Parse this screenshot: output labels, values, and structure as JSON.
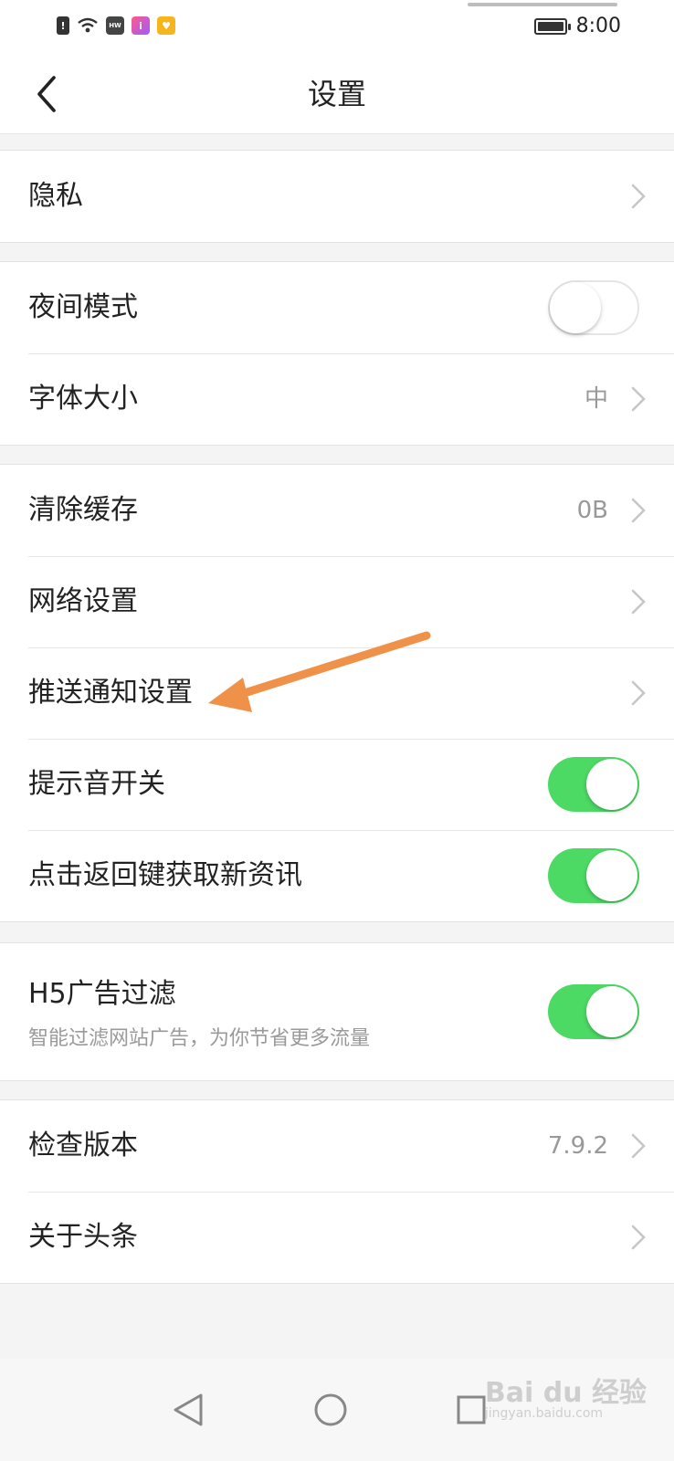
{
  "status": {
    "time": "8:00",
    "icons": [
      "sim-alert-icon",
      "wifi-icon",
      "huawei-icon",
      "app-icon",
      "shield-icon"
    ]
  },
  "header": {
    "title": "设置",
    "back_icon": "chevron-left-icon"
  },
  "groups": {
    "privacy": {
      "label": "隐私"
    },
    "night_mode": {
      "label": "夜间模式",
      "state": "off"
    },
    "font_size": {
      "label": "字体大小",
      "value": "中"
    },
    "clear_cache": {
      "label": "清除缓存",
      "value": "0B"
    },
    "network": {
      "label": "网络设置"
    },
    "push": {
      "label": "推送通知设置"
    },
    "sound": {
      "label": "提示音开关",
      "state": "on"
    },
    "back_refresh": {
      "label": "点击返回键获取新资讯",
      "state": "on"
    },
    "h5_filter": {
      "label": "H5广告过滤",
      "sub": "智能过滤网站广告，为你节省更多流量",
      "state": "on"
    },
    "version": {
      "label": "检查版本",
      "value": "7.9.2"
    },
    "about": {
      "label": "关于头条"
    }
  },
  "nav": {
    "back": "nav-back-icon",
    "home": "nav-home-icon",
    "recent": "nav-recent-icon"
  },
  "watermark": {
    "text": "Bai du 经验",
    "sub": "jingyan.baidu.com"
  },
  "colors": {
    "toggle_on": "#4cd964",
    "annotation_arrow": "#f0914a"
  }
}
